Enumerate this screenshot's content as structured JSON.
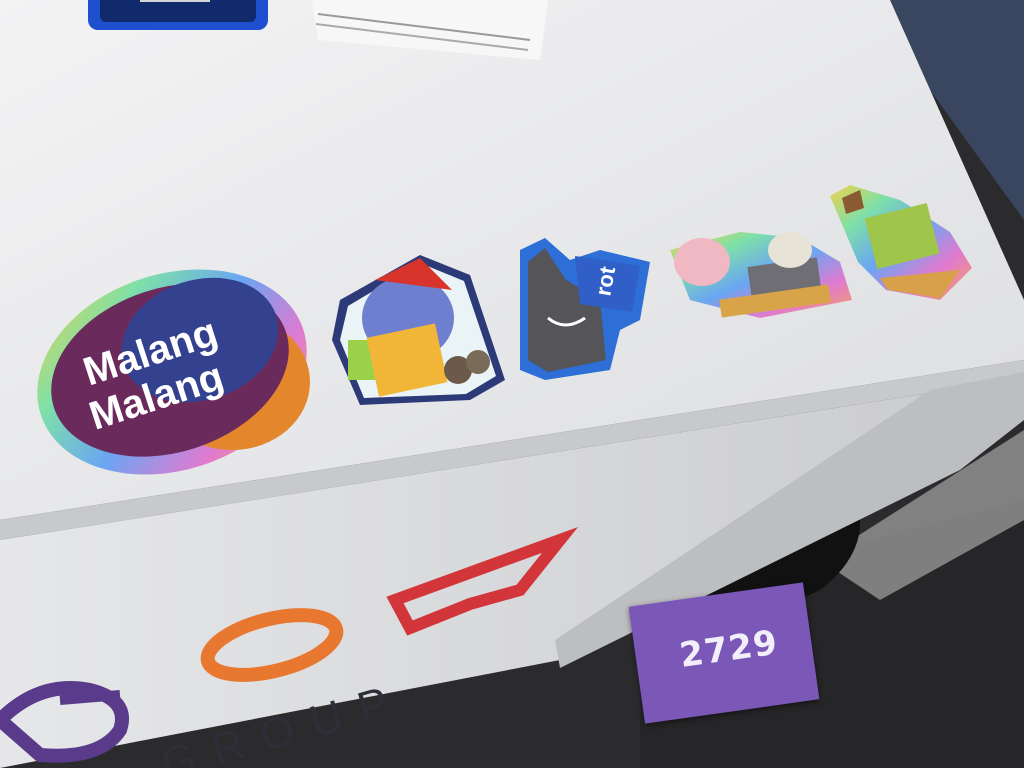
{
  "scene": {
    "description_colors": {
      "table_top": "#e9eaec",
      "table_front": "#dfe0e2",
      "floor": "#2b2b2d",
      "booth_label": "#7b57b8"
    }
  },
  "stickers": {
    "logo_line1": "Malang",
    "logo_line2": "Malang",
    "tag_text": "rot"
  },
  "booth": {
    "number": "2729"
  },
  "banner": {
    "group_text": "GROUP"
  }
}
